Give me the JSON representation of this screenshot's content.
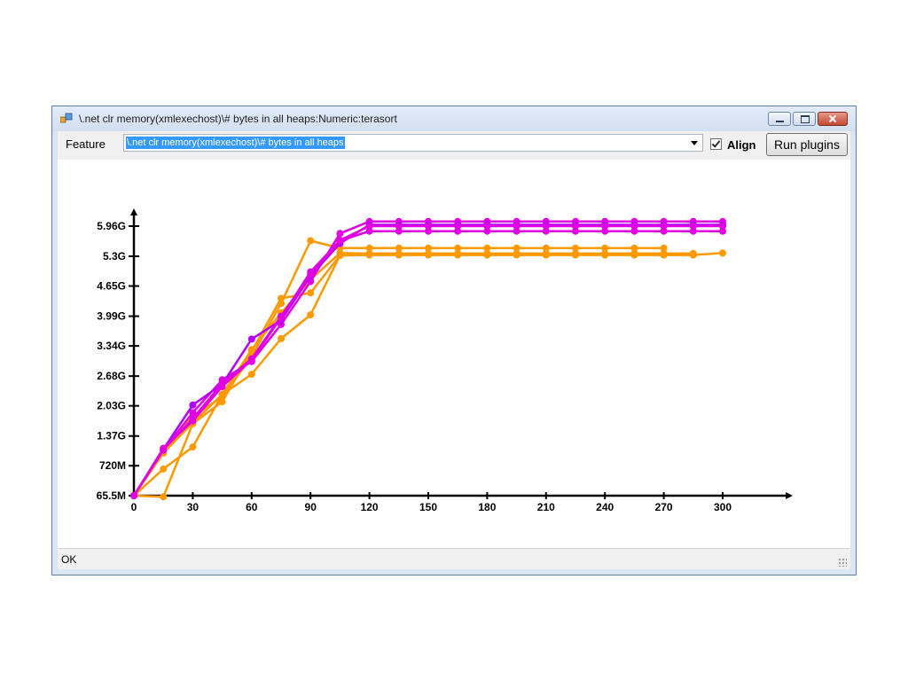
{
  "window": {
    "title": "\\.net clr memory(xmlexechost)\\# bytes in all heaps:Numeric:terasort",
    "app_icon": "app-icon",
    "min_icon": "minimize-icon",
    "max_icon": "maximize-icon",
    "close_icon": "close-icon"
  },
  "toolbar": {
    "feature_label": "Feature",
    "feature_value": "\\.net clr memory(xmlexechost)\\# bytes in all heaps",
    "align_label": "Align",
    "align_checked": true,
    "run_label": "Run plugins"
  },
  "status": {
    "text": "OK"
  },
  "chart_data": {
    "type": "line",
    "title": "",
    "xlabel": "",
    "ylabel": "",
    "xlim": [
      0,
      310
    ],
    "ylim": [
      65.5,
      6500
    ],
    "x_ticks": [
      {
        "value": 0,
        "label": "0"
      },
      {
        "value": 30,
        "label": "30"
      },
      {
        "value": 60,
        "label": "60"
      },
      {
        "value": 90,
        "label": "90"
      },
      {
        "value": 120,
        "label": "120"
      },
      {
        "value": 150,
        "label": "150"
      },
      {
        "value": 180,
        "label": "180"
      },
      {
        "value": 210,
        "label": "210"
      },
      {
        "value": 240,
        "label": "240"
      },
      {
        "value": 270,
        "label": "270"
      },
      {
        "value": 300,
        "label": "300"
      }
    ],
    "y_ticks": [
      {
        "value": 65.5,
        "label": "65.5M"
      },
      {
        "value": 720,
        "label": "720M"
      },
      {
        "value": 1370,
        "label": "1.37G"
      },
      {
        "value": 2030,
        "label": "2.03G"
      },
      {
        "value": 2680,
        "label": "2.68G"
      },
      {
        "value": 3340,
        "label": "3.34G"
      },
      {
        "value": 3990,
        "label": "3.99G"
      },
      {
        "value": 4650,
        "label": "4.65G"
      },
      {
        "value": 5300,
        "label": "5.3G"
      },
      {
        "value": 5960,
        "label": "5.96G"
      }
    ],
    "grid": false,
    "colors": {
      "orange": "#ff9900",
      "magenta": "#e100e1",
      "purple": "#b400ff"
    },
    "series": [
      {
        "color": "#ff9900",
        "x": [
          0,
          15,
          30,
          45,
          60,
          75,
          90,
          105,
          120,
          135,
          150,
          165,
          180,
          195,
          210,
          225,
          240,
          255,
          270,
          285,
          300
        ],
        "y": [
          65.5,
          650,
          1130,
          2280,
          2720,
          3500,
          4020,
          5320,
          5330,
          5330,
          5330,
          5330,
          5330,
          5330,
          5330,
          5330,
          5330,
          5330,
          5330,
          5330,
          5370
        ]
      },
      {
        "color": "#ff9900",
        "x": [
          0,
          15,
          30,
          45,
          60,
          75,
          90,
          105,
          120,
          135,
          150,
          165,
          180,
          195,
          210,
          225,
          240,
          255,
          270,
          285
        ],
        "y": [
          65.5,
          40,
          1640,
          2120,
          3220,
          4380,
          4500,
          5320,
          5330,
          5330,
          5330,
          5330,
          5330,
          5330,
          5330,
          5330,
          5330,
          5330,
          5330,
          5330
        ]
      },
      {
        "color": "#ff9900",
        "x": [
          0,
          15,
          30,
          45,
          60,
          75,
          90,
          105,
          120,
          135,
          150,
          165,
          180,
          195,
          210,
          225,
          240,
          255,
          270
        ],
        "y": [
          65.5,
          1000,
          1800,
          2230,
          3110,
          4270,
          5640,
          5480,
          5480,
          5480,
          5480,
          5480,
          5480,
          5480,
          5480,
          5480,
          5480,
          5480,
          5480
        ]
      },
      {
        "color": "#ff9900",
        "x": [
          0,
          15,
          30,
          45,
          60,
          75,
          90,
          105,
          120,
          135,
          150,
          165,
          180,
          195,
          210,
          225,
          240,
          255,
          270,
          285
        ],
        "y": [
          65.5,
          1000,
          1660,
          2280,
          3260,
          4060,
          4790,
          5370,
          5360,
          5360,
          5360,
          5360,
          5360,
          5360,
          5360,
          5360,
          5360,
          5360,
          5360,
          5360
        ]
      },
      {
        "color": "#e100e1",
        "x": [
          0,
          15,
          30,
          45,
          60,
          75,
          90,
          105,
          120,
          135,
          150,
          165,
          180,
          195,
          210,
          225,
          240,
          255,
          270,
          285,
          300
        ],
        "y": [
          65.5,
          1060,
          1880,
          2600,
          3000,
          3810,
          4750,
          5800,
          6060,
          6060,
          6060,
          6060,
          6060,
          6060,
          6060,
          6060,
          6060,
          6060,
          6060,
          6060,
          6060
        ]
      },
      {
        "color": "#b400ff",
        "x": [
          0,
          15,
          30,
          45,
          60,
          75,
          90,
          105,
          120,
          135,
          150,
          165,
          180,
          195,
          210,
          225,
          240,
          255,
          270,
          285,
          300
        ],
        "y": [
          65.5,
          1080,
          2050,
          2500,
          3490,
          3900,
          4870,
          5580,
          5990,
          5990,
          5990,
          5990,
          5990,
          5990,
          5990,
          5990,
          5990,
          5990,
          5990,
          5990,
          5990
        ]
      },
      {
        "color": "#e100e1",
        "x": [
          0,
          15,
          30,
          45,
          60,
          75,
          90,
          105,
          120,
          135,
          150,
          165,
          180,
          195,
          210,
          225,
          240,
          255,
          270,
          285,
          300
        ],
        "y": [
          65.5,
          1100,
          1700,
          2450,
          3030,
          3960,
          4960,
          5650,
          5960,
          5960,
          5960,
          5960,
          5960,
          5960,
          5960,
          5960,
          5960,
          5960,
          5960,
          5960,
          5960
        ]
      },
      {
        "color": "#e100e1",
        "x": [
          0,
          15,
          30,
          45,
          60,
          75,
          90,
          105,
          120,
          135,
          150,
          165,
          180,
          195,
          210,
          225,
          240,
          255,
          270,
          285,
          300
        ],
        "y": [
          65.5,
          1070,
          1750,
          2520,
          3060,
          3990,
          4910,
          5640,
          5850,
          5850,
          5850,
          5850,
          5850,
          5850,
          5850,
          5850,
          5850,
          5850,
          5850,
          5850,
          5850
        ]
      }
    ]
  }
}
